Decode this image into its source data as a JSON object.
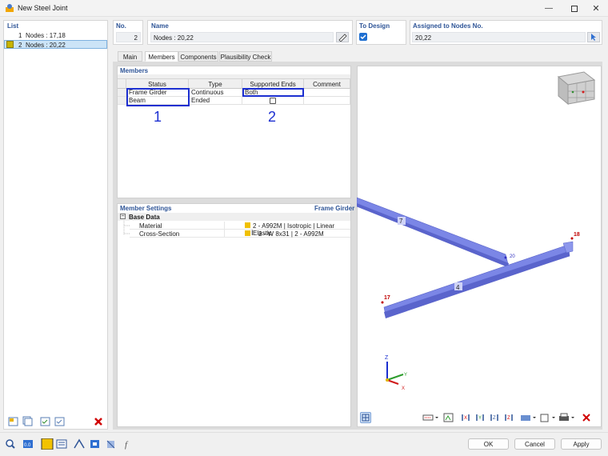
{
  "window": {
    "title": "New Steel Joint"
  },
  "list": {
    "header": "List",
    "items": [
      {
        "number": "1",
        "label": "Nodes : 17,18"
      },
      {
        "number": "2",
        "label": "Nodes : 20,22"
      }
    ]
  },
  "header": {
    "no_label": "No.",
    "no_value": "2",
    "name_label": "Name",
    "name_value": "Nodes : 20,22",
    "to_design_label": "To Design",
    "assigned_label": "Assigned to Nodes No.",
    "assigned_value": "20,22"
  },
  "tabs": [
    "Main",
    "Members",
    "Components",
    "Plausibility Check"
  ],
  "members": {
    "header": "Members",
    "columns": [
      "Status",
      "Type",
      "Supported Ends",
      "Comment"
    ],
    "rows": [
      {
        "status": "Frame Girder",
        "type": "Continuous",
        "supported": "Both",
        "comment": ""
      },
      {
        "status": "Beam",
        "type": "Ended",
        "supported": "",
        "comment": ""
      }
    ],
    "annotations": [
      "1",
      "2"
    ]
  },
  "member_settings": {
    "header": "Member Settings",
    "context": "Frame Girder",
    "group": "Base Data",
    "rows": [
      {
        "label": "Material",
        "value": "2 - A992M | Isotropic | Linear Elastic"
      },
      {
        "label": "Cross-Section",
        "value": "2 - W 8x31 | 2 - A992M"
      }
    ]
  },
  "viewport": {
    "member_labels": [
      "7",
      "4"
    ],
    "node_labels": [
      "18",
      "20",
      "17"
    ],
    "axes": {
      "z": "Z",
      "y": "Y",
      "x": "X"
    }
  },
  "buttons": {
    "ok": "OK",
    "cancel": "Cancel",
    "apply": "Apply"
  },
  "colors": {
    "accent": "#2f5597",
    "annotation": "#1c2fd1",
    "beam": "#7b86e6",
    "node": "#c00000",
    "material": "#f0c000"
  }
}
